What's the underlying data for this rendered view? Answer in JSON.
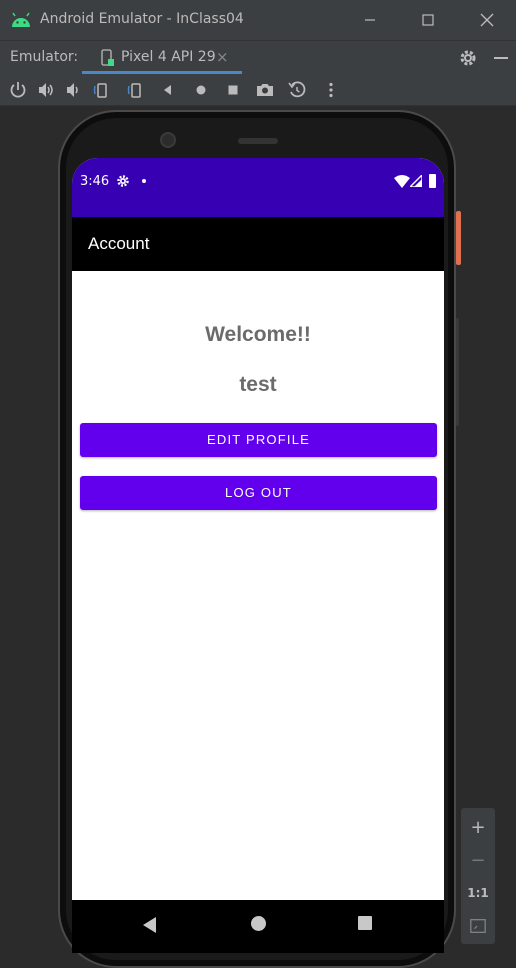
{
  "window": {
    "title": "Android Emulator - InClass04"
  },
  "toolbar": {
    "emulator_label": "Emulator:",
    "device_tab_label": "Pixel 4 API 29",
    "tab_close": "×"
  },
  "controls": [
    {
      "name": "power-icon"
    },
    {
      "name": "volume-up-icon"
    },
    {
      "name": "volume-down-icon"
    },
    {
      "name": "rotate-left-icon"
    },
    {
      "name": "rotate-right-icon"
    },
    {
      "name": "back-icon"
    },
    {
      "name": "home-icon"
    },
    {
      "name": "overview-icon"
    },
    {
      "name": "screenshot-icon"
    },
    {
      "name": "snapshot-icon"
    },
    {
      "name": "more-icon"
    }
  ],
  "status_bar": {
    "time": "3:46"
  },
  "app": {
    "title": "Account",
    "welcome_text": "Welcome!!",
    "username": "test",
    "edit_profile_label": "EDIT PROFILE",
    "logout_label": "LOG OUT"
  },
  "zoom": {
    "plus": "+",
    "minus": "−",
    "one_to_one": "1:1"
  },
  "colors": {
    "status_bar": "#3700b3",
    "app_bar": "#000000",
    "button": "#6200ee",
    "text_secondary": "#6b6b6b",
    "ide_background": "#3c3f41",
    "tab_accent": "#4a88c7"
  }
}
